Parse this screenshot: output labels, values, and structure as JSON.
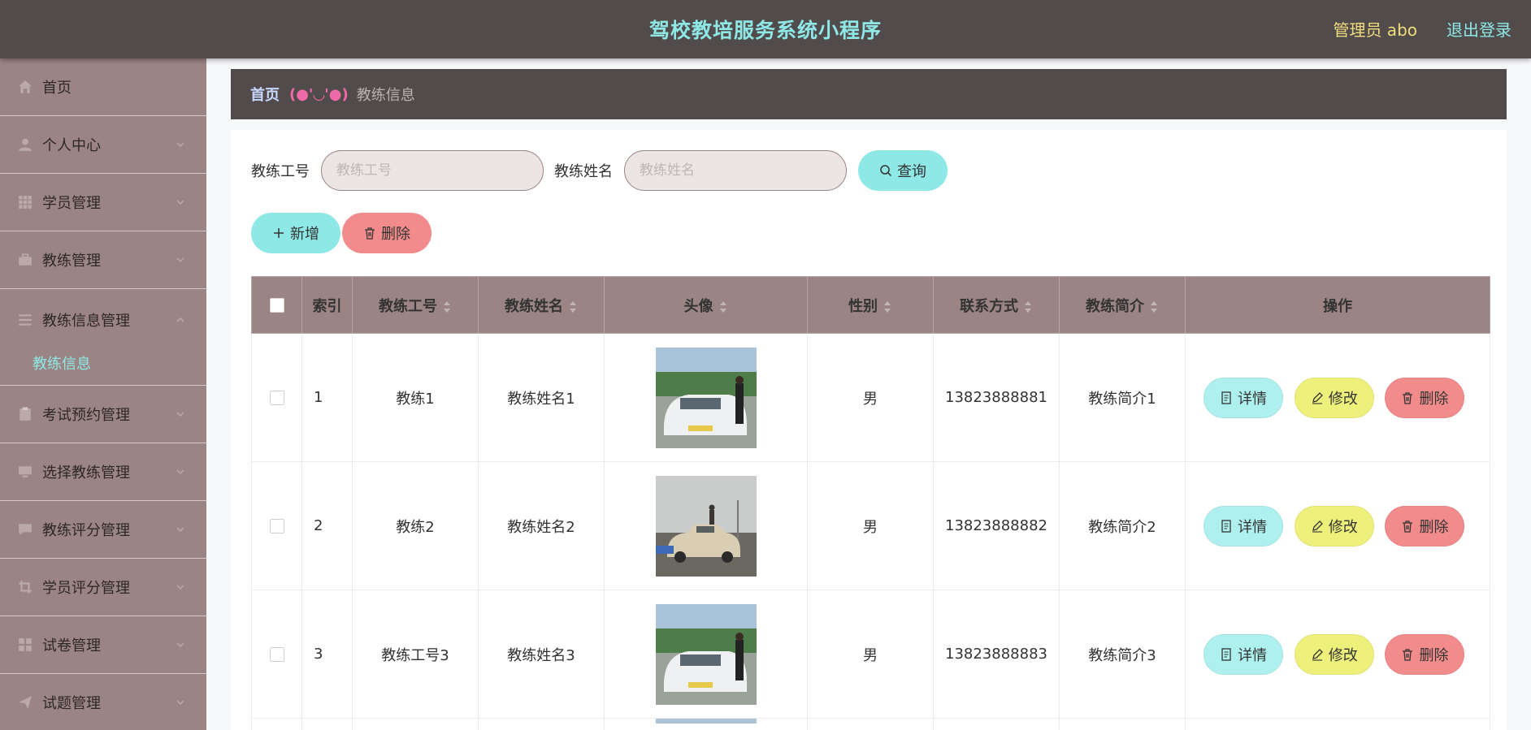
{
  "header": {
    "title": "驾校教培服务系统小程序",
    "admin_label": "管理员 abo",
    "logout": "退出登录"
  },
  "sidebar": {
    "items": [
      {
        "label": "首页",
        "icon": "home-icon"
      },
      {
        "label": "个人中心",
        "icon": "user-icon"
      },
      {
        "label": "学员管理",
        "icon": "grid-icon"
      },
      {
        "label": "教练管理",
        "icon": "briefcase-icon"
      },
      {
        "label": "教练信息管理",
        "icon": "list-icon"
      },
      {
        "label": "考试预约管理",
        "icon": "clipboard-icon"
      },
      {
        "label": "选择教练管理",
        "icon": "monitor-icon"
      },
      {
        "label": "教练评分管理",
        "icon": "chat-icon"
      },
      {
        "label": "学员评分管理",
        "icon": "crop-icon"
      },
      {
        "label": "试卷管理",
        "icon": "apps-icon"
      },
      {
        "label": "试题管理",
        "icon": "send-icon"
      }
    ],
    "active_submenu": "教练信息"
  },
  "breadcrumb": {
    "home": "首页",
    "separator": "(●'◡'●)",
    "current": "教练信息"
  },
  "search": {
    "field1_label": "教练工号",
    "field1_placeholder": "教练工号",
    "field1_value": "",
    "field2_label": "教练姓名",
    "field2_placeholder": "教练姓名",
    "field2_value": "",
    "query_button": "查询"
  },
  "actions": {
    "add_button": "新增",
    "delete_button": "删除"
  },
  "table": {
    "columns": [
      "索引",
      "教练工号",
      "教练姓名",
      "头像",
      "性别",
      "联系方式",
      "教练简介",
      "操作"
    ],
    "rows": [
      {
        "index": "1",
        "coach_id": "教练1",
        "coach_name": "教练姓名1",
        "gender": "男",
        "phone": "13823888881",
        "intro": "教练简介1"
      },
      {
        "index": "2",
        "coach_id": "教练2",
        "coach_name": "教练姓名2",
        "gender": "男",
        "phone": "13823888882",
        "intro": "教练简介2"
      },
      {
        "index": "3",
        "coach_id": "教练工号3",
        "coach_name": "教练姓名3",
        "gender": "男",
        "phone": "13823888883",
        "intro": "教练简介3"
      }
    ],
    "op_detail": "详情",
    "op_edit": "修改",
    "op_delete": "删除"
  },
  "colors": {
    "topbar": "#524b4b",
    "sidebar": "#9b8484",
    "accent_cyan": "#8ee8e6",
    "accent_yellow": "#eef07c",
    "accent_red": "#f28b8b"
  }
}
